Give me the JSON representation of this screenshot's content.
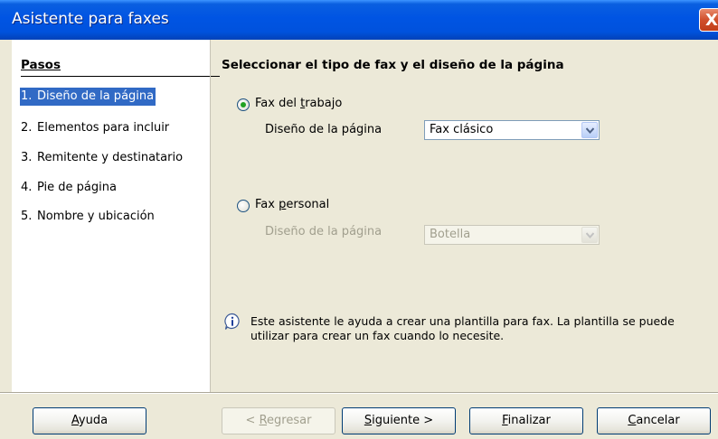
{
  "window": {
    "title": "Asistente para faxes",
    "close_glyph": "X"
  },
  "steps": {
    "heading": "Pasos",
    "items": [
      {
        "num": "1.",
        "label": "Diseño de la página",
        "selected": true
      },
      {
        "num": "2.",
        "label": "Elementos para incluir",
        "selected": false
      },
      {
        "num": "3.",
        "label": "Remitente y destinatario",
        "selected": false
      },
      {
        "num": "4.",
        "label": "Pie de página",
        "selected": false
      },
      {
        "num": "5.",
        "label": "Nombre y ubicación",
        "selected": false
      }
    ]
  },
  "main": {
    "title": "Seleccionar el tipo de fax y el diseño de la página",
    "business": {
      "label_pre": "Fax del ",
      "label_key": "t",
      "label_post": "rabajo",
      "checked": true,
      "layout_label": "Diseño de la página",
      "layout_value": "Fax clásico"
    },
    "personal": {
      "label_pre": "Fax ",
      "label_key": "p",
      "label_post": "ersonal",
      "checked": false,
      "layout_label": "Diseño de la página",
      "layout_value": "Botella"
    },
    "info_line1": "Este asistente le ayuda a crear una plantilla para fax. La plantilla se puede",
    "info_line2": "utilizar para crear un fax cuando lo necesite."
  },
  "buttons": {
    "help": {
      "key": "A",
      "rest": "yuda"
    },
    "back": {
      "pre": "< ",
      "key": "R",
      "rest": "egresar"
    },
    "next": {
      "key": "S",
      "rest": "iguiente >"
    },
    "finish": {
      "key": "F",
      "rest": "inalizar"
    },
    "cancel": {
      "key": "C",
      "rest": "ancelar"
    }
  },
  "colors": {
    "titlebar": "#0054e3",
    "selection": "#316ac5",
    "radio_dot": "#21a121",
    "dialog_bg": "#ece9d8"
  }
}
